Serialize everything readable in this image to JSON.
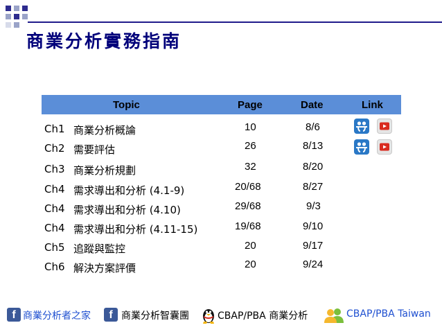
{
  "title": "商業分析實務指南",
  "table": {
    "headers": {
      "topic": "Topic",
      "page": "Page",
      "date": "Date",
      "link": "Link"
    },
    "rows": [
      {
        "ch": "Ch1",
        "topic": "商業分析概論",
        "page": "10",
        "date": "8/6",
        "links": true
      },
      {
        "ch": "Ch2",
        "topic": "需要評估",
        "page": "26",
        "date": "8/13",
        "links": true
      },
      {
        "ch": "Ch3",
        "topic": "商業分析規劃",
        "page": "32",
        "date": "8/20",
        "links": false
      },
      {
        "ch": "Ch4",
        "topic": "需求導出和分析 (4.1-9)",
        "page": "20/68",
        "date": "8/27",
        "links": false
      },
      {
        "ch": "Ch4",
        "topic": "需求導出和分析 (4.10)",
        "page": "29/68",
        "date": "9/3",
        "links": false
      },
      {
        "ch": "Ch4",
        "topic": "需求導出和分析 (4.11-15)",
        "page": "19/68",
        "date": "9/10",
        "links": false
      },
      {
        "ch": "Ch5",
        "topic": "追蹤與監控",
        "page": "20",
        "date": "9/17",
        "links": false
      },
      {
        "ch": "Ch6",
        "topic": "解決方案評價",
        "page": "20",
        "date": "9/24",
        "links": false
      }
    ]
  },
  "footer": {
    "link1": "商業分析者之家",
    "link2": "商業分析智囊團",
    "link3": "CBAP/PBA 商業分析",
    "link4": "CBAP/PBA Taiwan"
  },
  "colors": {
    "title": "#00007a",
    "header_bg": "#5b8ed8",
    "footer_link": "#1e4fd0",
    "facebook": "#3b5998"
  },
  "icons": {
    "row_link_1": "slideshare-icon",
    "row_link_2": "youtube-icon",
    "footer_1": "facebook-icon",
    "footer_2": "facebook-icon",
    "footer_3": "penguin-icon",
    "footer_4": "users-icon"
  }
}
